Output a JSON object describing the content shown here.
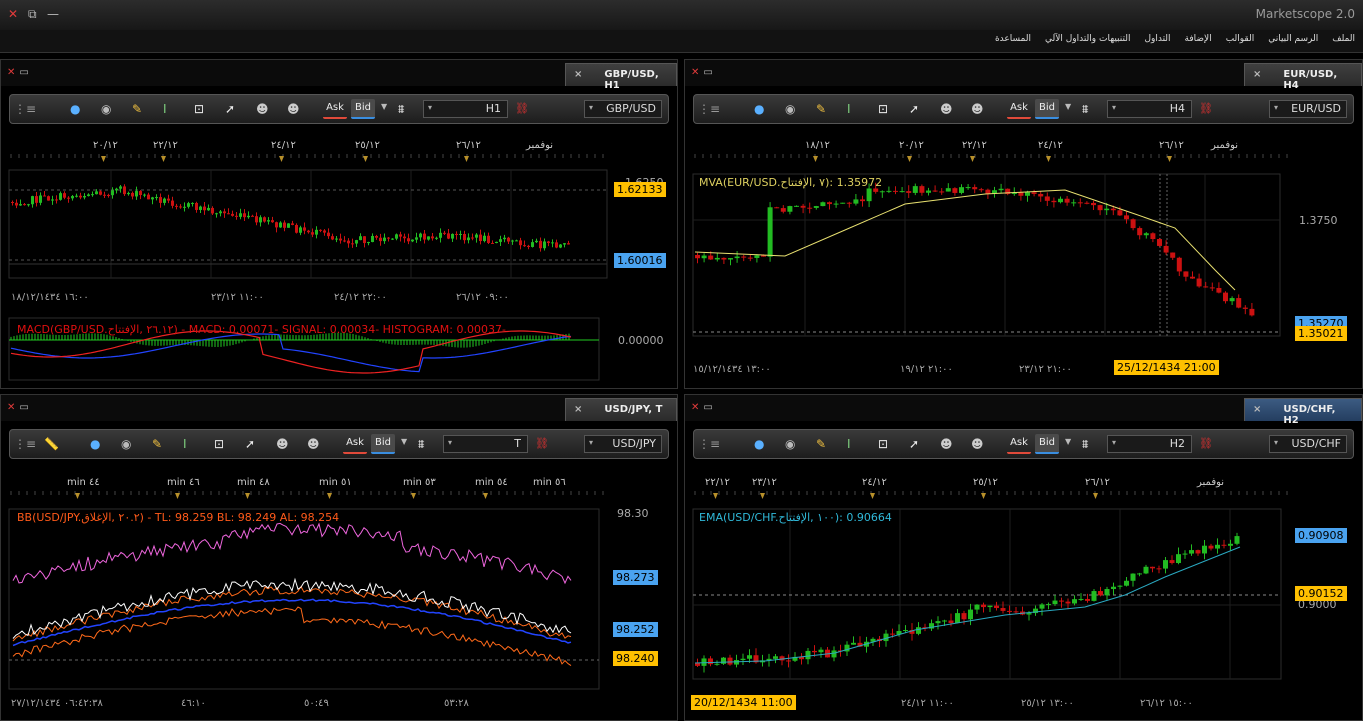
{
  "app": {
    "title": "Marketscope  2.0"
  },
  "window_icons": [
    "close-icon",
    "restore-icon",
    "minimize-icon"
  ],
  "menu": [
    "الملف",
    "الرسم البياني",
    "القوالب",
    "الإضافة",
    "التداول",
    "التنبيهات والتداول الآلي",
    "المساعدة"
  ],
  "toolbar": {
    "ask": "Ask",
    "bid": "Bid"
  },
  "colors": {
    "up": "#22bb22",
    "down": "#cc1111",
    "price_yellow": "#ffc000",
    "price_blue": "#4aa3f0",
    "tab_active": "#2f4d72"
  },
  "panels": {
    "gbp": {
      "tab": "GBP/USD, H1",
      "tab_close": "×",
      "timeframe": "H1",
      "symbol": "GBP/USD",
      "top_labels": [
        "٢٠/١٢",
        "٢٢/١٢",
        "٢٤/١٢",
        "٢٥/١٢",
        "٢٦/١٢",
        "نوفمبر"
      ],
      "price_axis": [
        "1.6250"
      ],
      "last": "1.62133",
      "current": "1.60016",
      "bottom_labels": [
        "١٦:٠٠ ١٨/١٢/١٤٣٤",
        "١١:٠٠ ٢٣/١٢",
        "٢٢:٠٠ ٢٤/١٢",
        "٠٩:٠٠ ٢٦/١٢"
      ],
      "indicator": "MACD(GBP/USD.٢٦.١٢ ,الإفتتاح) - MACD: 0.00071- SIGNAL: 0.00034- HISTOGRAM: 0.00037-",
      "indicator_axis": "0.00000"
    },
    "eur": {
      "tab": "EUR/USD, H4",
      "tab_close": "×",
      "timeframe": "H4",
      "symbol": "EUR/USD",
      "top_labels": [
        "١٨/١٢",
        "٢٠/١٢",
        "٢٢/١٢",
        "٢٤/١٢",
        "٢٦/١٢",
        "نوفمبر"
      ],
      "price_axis": [
        "1.3750"
      ],
      "upper": "1.35270",
      "current": "1.35021",
      "bottom_labels": [
        "١٣:٠٠ ١٥/١٢/١٤٣٤",
        "٢١:٠٠ ١٩/١٢",
        "٢١:٠٠ ٢٣/١٢"
      ],
      "indicator": "MVA(EUR/USD.٧ ,الإفتتاح): 1.35972",
      "crosshair_time": "25/12/1434 21:00"
    },
    "jpy": {
      "tab": "USD/JPY, T",
      "tab_close": "×",
      "timeframe": "T",
      "symbol": "USD/JPY",
      "top_labels": [
        "min ٤٤",
        "min ٤٦",
        "min ٤٨",
        "min ٥١",
        "min ٥٣",
        "min ٥٤",
        "min ٥٦"
      ],
      "price_axis": [
        "98.30"
      ],
      "p1": "98.273",
      "p2": "98.252",
      "p3": "98.240",
      "bottom_labels": [
        "٠٦:٤٢:٣٨ ٢٧/١٢/١٤٣٤",
        "٤٦:١٠",
        "٥٠:٤٩",
        "٥٣:٢٨"
      ],
      "indicator": "BB(USD/JPY.٢٠.٢ ,الإغلاق) - TL: 98.259  BL: 98.249  AL: 98.254"
    },
    "chf": {
      "tab": "USD/CHF, H2",
      "tab_close": "×",
      "timeframe": "H2",
      "symbol": "USD/CHF",
      "top_labels": [
        "٢٢/١٢",
        "٢٣/١٢",
        "٢٤/١٢",
        "٢٥/١٢",
        "٢٦/١٢",
        "نوفمبر"
      ],
      "price_axis": [
        "0.9000"
      ],
      "upper": "0.90908",
      "current": "0.90152",
      "bottom_labels": [
        "١١:٠٠ ٢٤/١٢",
        "١٣:٠٠ ٢٥/١٢",
        "١٥:٠٠ ٢٦/١٢"
      ],
      "indicator": "EMA(USD/CHF.١٠٠ ,الإفتتاح): 0.90664",
      "crosshair_time": "20/12/1434 11:00"
    }
  }
}
